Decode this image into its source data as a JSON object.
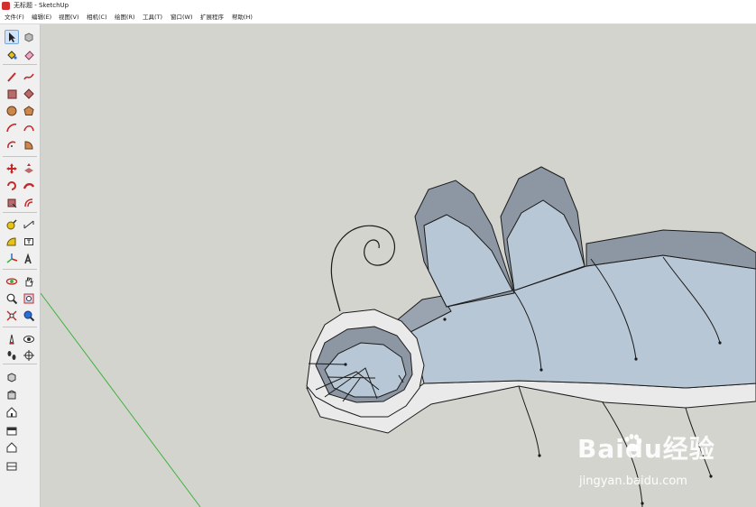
{
  "window": {
    "title": "无标题 - SketchUp"
  },
  "menu": [
    "文件(F)",
    "编辑(E)",
    "视图(V)",
    "相机(C)",
    "绘图(R)",
    "工具(T)",
    "窗口(W)",
    "扩展程序",
    "帮助(H)"
  ],
  "toolbar": {
    "tools": [
      "select-tool",
      "make-component-tool",
      "paint-bucket-tool",
      "eraser-tool",
      "line-tool",
      "freehand-tool",
      "rectangle-tool",
      "rotated-rectangle-tool",
      "circle-tool",
      "polygon-tool",
      "arc-tool",
      "two-point-arc-tool",
      "three-point-arc-tool",
      "pie-tool",
      "move-tool",
      "push-pull-tool",
      "rotate-tool",
      "follow-me-tool",
      "scale-tool",
      "offset-tool",
      "tape-measure-tool",
      "dimension-tool",
      "protractor-tool",
      "text-tool",
      "axes-tool",
      "3d-text-tool",
      "orbit-tool",
      "pan-tool",
      "zoom-tool",
      "zoom-window-tool",
      "zoom-extents-tool",
      "previous-view-tool",
      "position-camera-tool",
      "look-around-tool",
      "walk-tool",
      "section-plane-tool",
      "iso-view-tool",
      "top-view-tool",
      "front-view-tool",
      "right-view-tool",
      "back-view-tool",
      "left-view-tool"
    ],
    "active_tool": "select-tool"
  },
  "viewport": {
    "background_color": "#d4d4cf",
    "model": "mouse-shaped 3D model"
  },
  "colors": {
    "face_front": "#b8c7d6",
    "face_side": "#eaeaea",
    "edge": "#1a1a1a",
    "axis_green": "#3fb33f"
  },
  "watermark": {
    "brand": "Baidu经验",
    "url": "jingyan.baidu.com"
  }
}
